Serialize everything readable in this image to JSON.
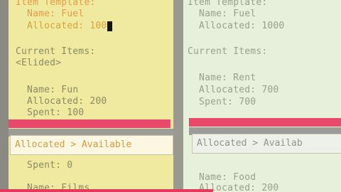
{
  "left_pane": {
    "lines": [
      "Item Template:",
      "  Name: Fuel",
      "  Allocated: 100",
      "",
      "Current Items:",
      "<Elided>",
      "",
      "",
      "  Name: Fun",
      "  Allocated: 200",
      "  Spent: 100"
    ],
    "lower_lines": [
      "  Spent: 0",
      "",
      "  Name: Films"
    ]
  },
  "right_pane": {
    "lines": [
      "Item Template:",
      "  Name: Fuel",
      "  Allocated: 1000",
      "",
      "Current Items:",
      "",
      "",
      "  Name: Rent",
      "  Allocated: 700",
      "  Spent: 700"
    ],
    "lower_lines": [
      "  Name: Food",
      "  Allocated: 200"
    ]
  },
  "error_popup": {
    "left_message": "Allocated > Available",
    "right_message": "Allocated > Availab"
  },
  "colors": {
    "left_bg": "#efeaa0",
    "right_bg": "#e7f0da",
    "error_bar": "#e8486a",
    "highlight_text": "#e69a4a"
  }
}
